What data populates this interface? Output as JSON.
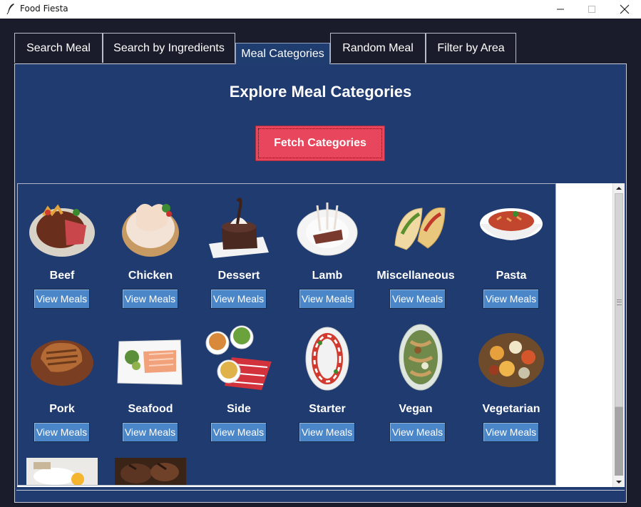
{
  "window": {
    "title": "Food Fiesta",
    "minimize_icon": "minimize-icon",
    "maximize_icon": "maximize-icon",
    "close_icon": "close-icon"
  },
  "tabs": [
    {
      "label": "Search Meal",
      "active": false
    },
    {
      "label": "Search by Ingredients",
      "active": false
    },
    {
      "label": "Meal Categories",
      "active": true
    },
    {
      "label": "Random Meal",
      "active": false
    },
    {
      "label": "Filter by Area",
      "active": false
    }
  ],
  "panel": {
    "heading": "Explore Meal Categories",
    "fetch_button": "Fetch Categories"
  },
  "categories": [
    {
      "name": "Beef",
      "button": "View Meals",
      "image": "beef-steak-photo"
    },
    {
      "name": "Chicken",
      "button": "View Meals",
      "image": "raw-chicken-photo"
    },
    {
      "name": "Dessert",
      "button": "View Meals",
      "image": "chocolate-dessert-photo"
    },
    {
      "name": "Lamb",
      "button": "View Meals",
      "image": "lamb-rack-photo"
    },
    {
      "name": "Miscellaneous",
      "button": "View Meals",
      "image": "tacos-photo"
    },
    {
      "name": "Pasta",
      "button": "View Meals",
      "image": "pasta-bowl-photo"
    },
    {
      "name": "Pork",
      "button": "View Meals",
      "image": "pork-chop-photo"
    },
    {
      "name": "Seafood",
      "button": "View Meals",
      "image": "salmon-plate-photo"
    },
    {
      "name": "Side",
      "button": "View Meals",
      "image": "side-dishes-photo"
    },
    {
      "name": "Starter",
      "button": "View Meals",
      "image": "caprese-starter-photo"
    },
    {
      "name": "Vegan",
      "button": "View Meals",
      "image": "vegan-bowl-photo"
    },
    {
      "name": "Vegetarian",
      "button": "View Meals",
      "image": "vegetarian-platter-photo"
    }
  ],
  "partial_images": [
    "breakfast-photo",
    "goat-meat-photo"
  ],
  "colors": {
    "panel_bg": "#1f3b70",
    "fetch_button": "#e8465d",
    "view_button": "#4a86c8",
    "tab_bg": "#1b1c2b"
  }
}
